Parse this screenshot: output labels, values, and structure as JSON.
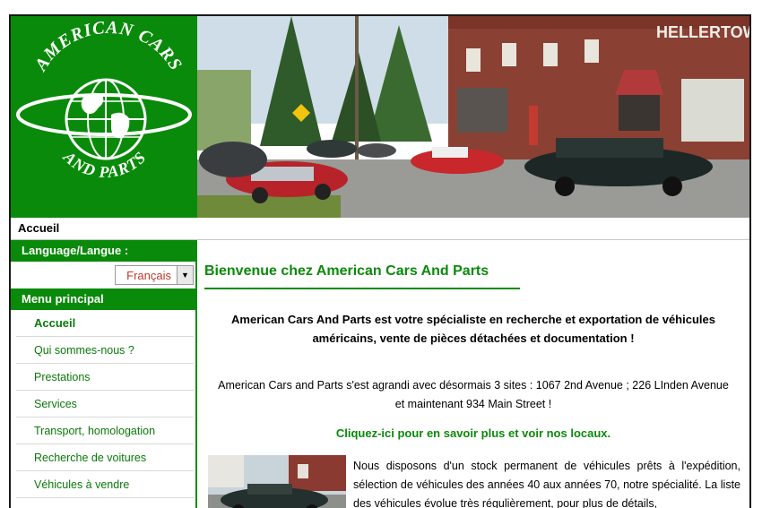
{
  "header": {
    "logo_line1": "AMERICAN CARS",
    "logo_line2": "AND PARTS",
    "photo_sign": "HELLERTOWN"
  },
  "breadcrumb": "Accueil",
  "sidebar": {
    "language_heading": "Language/Langue :",
    "language_selected": "Français",
    "menu_heading": "Menu principal",
    "items": [
      {
        "label": "Accueil"
      },
      {
        "label": "Qui sommes-nous ?"
      },
      {
        "label": "Prestations"
      },
      {
        "label": "Services"
      },
      {
        "label": "Transport, homologation"
      },
      {
        "label": "Recherche de voitures"
      },
      {
        "label": "Véhicules à vendre"
      }
    ]
  },
  "main": {
    "title": "Bienvenue chez American Cars And Parts",
    "intro": "American Cars And Parts est votre spécialiste en recherche et exportation de véhicules américains, vente de pièces détachées et documentation !",
    "para1": "American Cars and Parts s'est agrandi avec désormais 3 sites : 1067 2nd Avenue ; 226 LInden Avenue et maintenant 934 Main Street !",
    "link_more": "Cliquez-ici pour en savoir plus et voir nos locaux.",
    "para2": "Nous disposons d'un stock permanent de véhicules prêts à l'expédition, sélection de véhicules des années 40 aux années 70, notre spécialité. La liste des véhicules évolue très régulièrement, pour plus de détails,"
  },
  "colors": {
    "brand_green": "#0a8a0a",
    "link_green": "#0a7a0a",
    "lang_red": "#c0392b"
  }
}
